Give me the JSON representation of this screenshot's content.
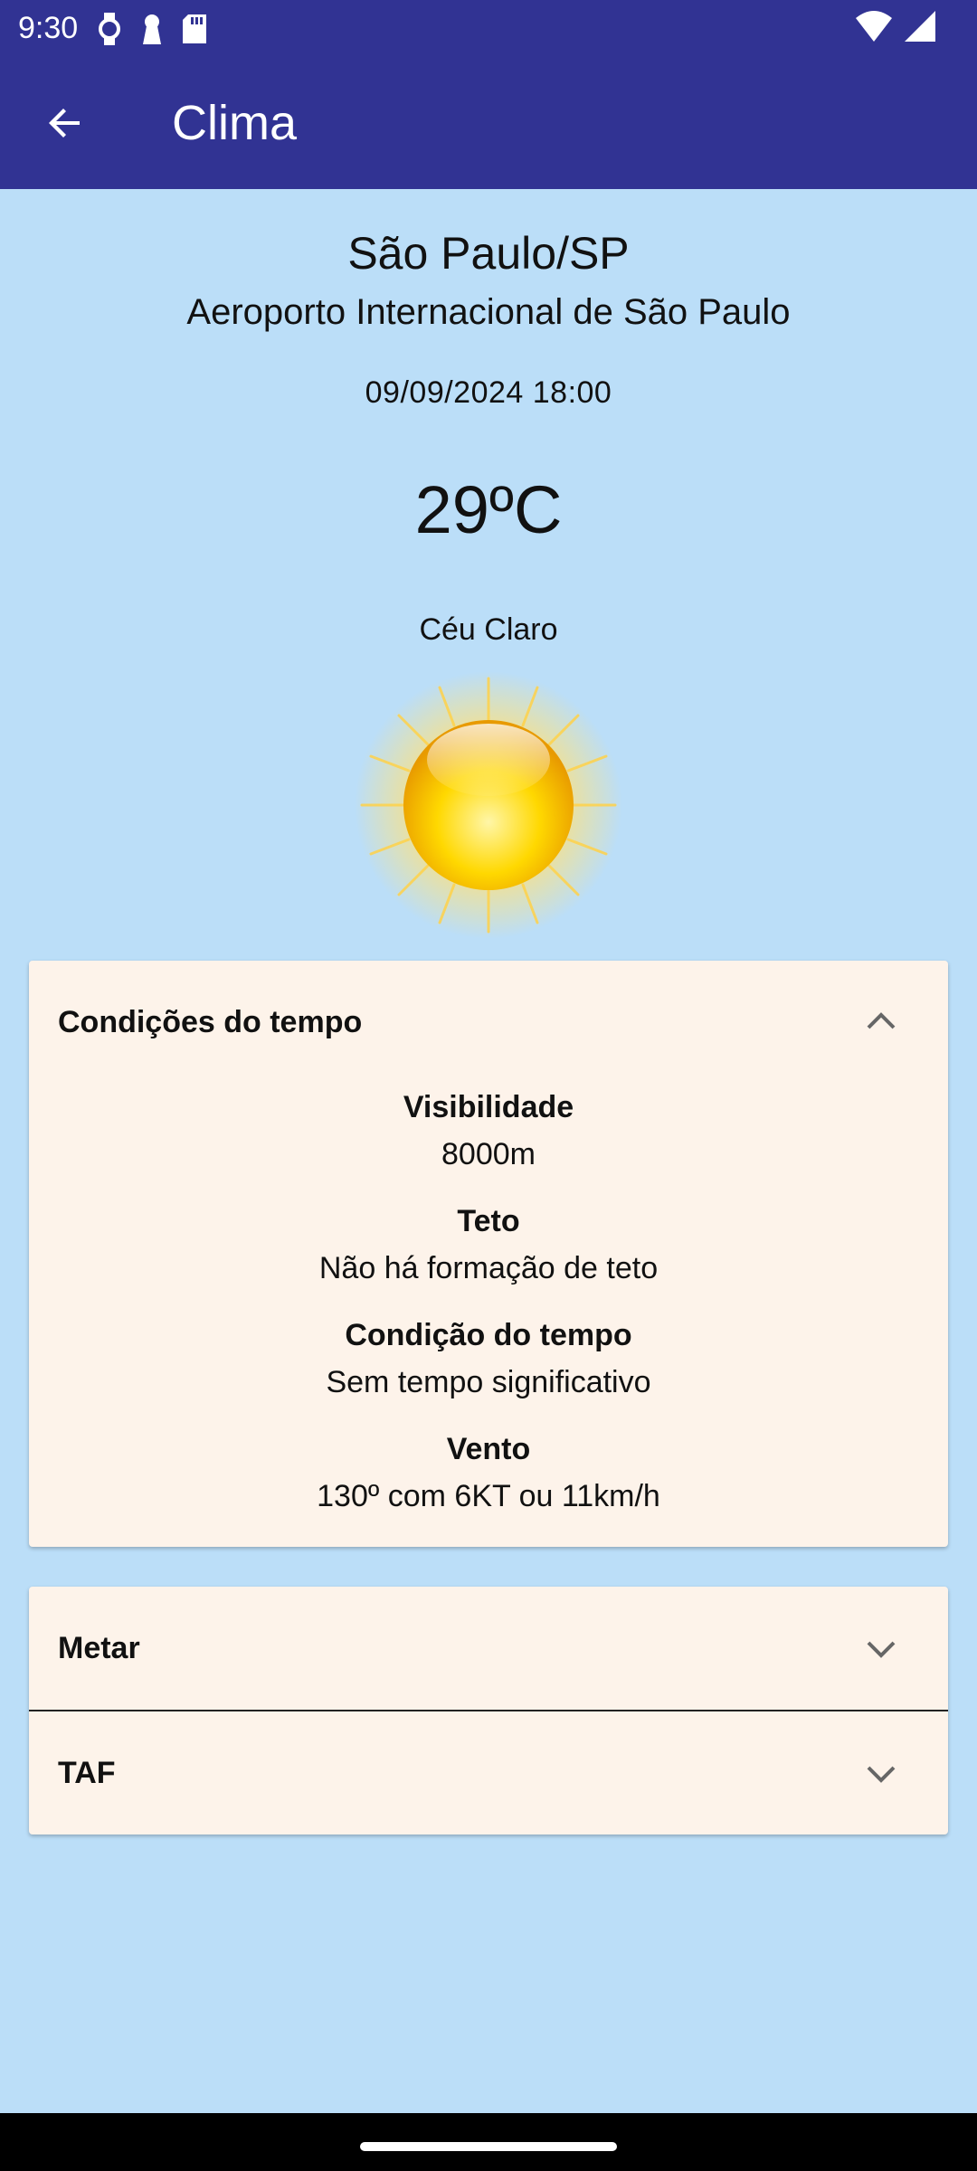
{
  "status_bar": {
    "time": "9:30"
  },
  "app_bar": {
    "title": "Clima"
  },
  "location": {
    "city": "São Paulo/SP",
    "airport": "Aeroporto Internacional de São Paulo"
  },
  "observation": {
    "datetime": "09/09/2024 18:00",
    "temperature": "29ºC",
    "condition": "Céu Claro"
  },
  "conditions_panel": {
    "title": "Condições do tempo",
    "expanded": true,
    "items": [
      {
        "label": "Visibilidade",
        "value": "8000m"
      },
      {
        "label": "Teto",
        "value": "Não há formação de teto"
      },
      {
        "label": "Condição do tempo",
        "value": "Sem tempo significativo"
      },
      {
        "label": "Vento",
        "value": "130º com 6KT ou 11km/h"
      }
    ]
  },
  "metar_panel": {
    "title": "Metar",
    "expanded": false
  },
  "taf_panel": {
    "title": "TAF",
    "expanded": false
  },
  "colors": {
    "primary": "#313393",
    "background": "#bbdef8",
    "card": "#fdf3ea"
  },
  "icons": {
    "back": "arrow-left-icon",
    "sun": "sun-icon",
    "expanded_chevron": "chevron-up-icon",
    "collapsed_chevron": "chevron-down-icon"
  }
}
